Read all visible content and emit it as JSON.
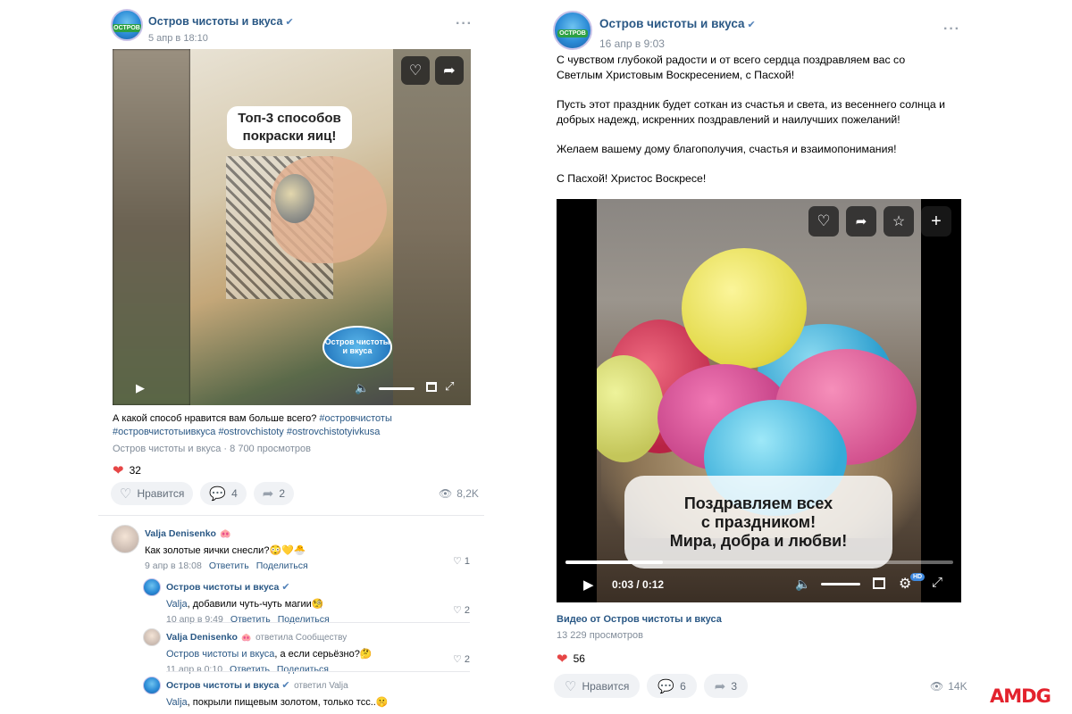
{
  "left_post": {
    "author": "Остров чистоты и вкуса",
    "time": "5 апр в 18:10",
    "video_overlay_text": "Топ-3 способов покраски яиц!",
    "video_logo_text": "Остров чистоты и вкуса",
    "caption_line1_text": "А какой способ нравится вам больше всего? ",
    "caption_tags_line1": "#островчистоты",
    "caption_tags_line2": "#островчистотыивкуса #ostrovchistoty #ostrovchistotyivkusa",
    "source": "Остров чистоты и вкуса · 8 700 просмотров",
    "likes_count": "32",
    "like_label": "Нравится",
    "comments_count": "4",
    "shares_count": "2",
    "views": "8,2K"
  },
  "comments": [
    {
      "author": "Valja Denisenko",
      "text": "Как золотые яички снесли?😳💛🐣",
      "date": "9 апр в 18:08",
      "reply": "Ответить",
      "share": "Поделиться",
      "likes": "1"
    },
    {
      "author": "Остров чистоты и вкуса",
      "text_name": "Valja",
      "text_rest": ", добавили чуть-чуть магии🧐",
      "date": "10 апр в 9:49",
      "reply": "Ответить",
      "share": "Поделиться",
      "likes": "2"
    },
    {
      "author": "Valja Denisenko",
      "note": "ответила Сообществу",
      "text_name": "Остров чистоты и вкуса",
      "text_rest": ", а если серьёзно?🤔",
      "date": "11 апр в 0:10",
      "reply": "Ответить",
      "share": "Поделиться",
      "likes": "2"
    },
    {
      "author": "Остров чистоты и вкуса",
      "note": "ответил Valja",
      "text_name": "Valja",
      "text_rest": ", покрыли пищевым золотом, только тсс..🤫"
    }
  ],
  "right_post": {
    "author": "Остров чистоты и вкуса",
    "time": "16 апр в 9:03",
    "paragraphs": [
      "С чувством глубокой радости и от всего сердца поздравляем вас со Светлым Христовым Воскресением, с Пасхой!",
      "Пусть этот праздник будет соткан из счастья и света, из весеннего солнца и добрых надежд, искренних поздравлений и наилучших пожеланий!",
      "Желаем вашему дому благополучия, счастья и взаимопонимания!",
      "С Пасхой! Христос Воскресе!"
    ],
    "video_overlay_lines": [
      "Поздравляем всех",
      "с праздником!",
      "Мира, добра и любви!"
    ],
    "video_time": "0:03 / 0:12",
    "video_progress": 0.25,
    "hd_badge": "HD",
    "video_title": "Видео от Остров чистоты и вкуса",
    "video_views": "13 229 просмотров",
    "likes_count": "56",
    "like_label": "Нравится",
    "comments_count": "6",
    "shares_count": "3",
    "views": "14K"
  },
  "watermark": "AMDG",
  "colors": {
    "link": "#2a5885",
    "meta": "#818c99",
    "heart": "#e64646",
    "brand": "#e3222d"
  }
}
